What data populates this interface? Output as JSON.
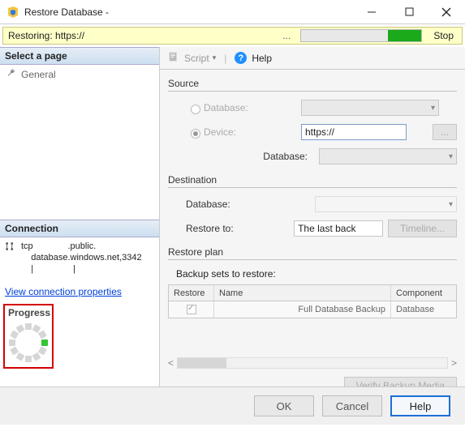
{
  "window": {
    "title": "Restore Database -"
  },
  "banner": {
    "text": "Restoring: https://",
    "ellipsis": "...",
    "stop": "Stop"
  },
  "left": {
    "select_page": "Select a page",
    "general": "General",
    "connection": "Connection",
    "conn_line1": "tcp              .public.",
    "conn_line2": "    database.windows.net,3342",
    "conn_line3": "    |                |",
    "view_props": "View connection properties",
    "progress": "Progress"
  },
  "toolbar": {
    "script": "Script",
    "help": "Help",
    "help_icon": "?"
  },
  "source": {
    "title": "Source",
    "database_label": "Database:",
    "device_label": "Device:",
    "device_value": "https://",
    "ellipsis": "...",
    "database2_label": "Database:"
  },
  "dest": {
    "title": "Destination",
    "database_label": "Database:",
    "restore_to_label": "Restore to:",
    "restore_to_value": "The last back",
    "timeline": "Timeline..."
  },
  "plan": {
    "title": "Restore plan",
    "subtitle": "Backup sets to restore:",
    "col_restore": "Restore",
    "col_name": "Name",
    "col_component": "Component",
    "row_name": "Full Database Backup",
    "row_component": "Database",
    "verify": "Verify Backup Media"
  },
  "footer": {
    "ok": "OK",
    "cancel": "Cancel",
    "help": "Help"
  }
}
